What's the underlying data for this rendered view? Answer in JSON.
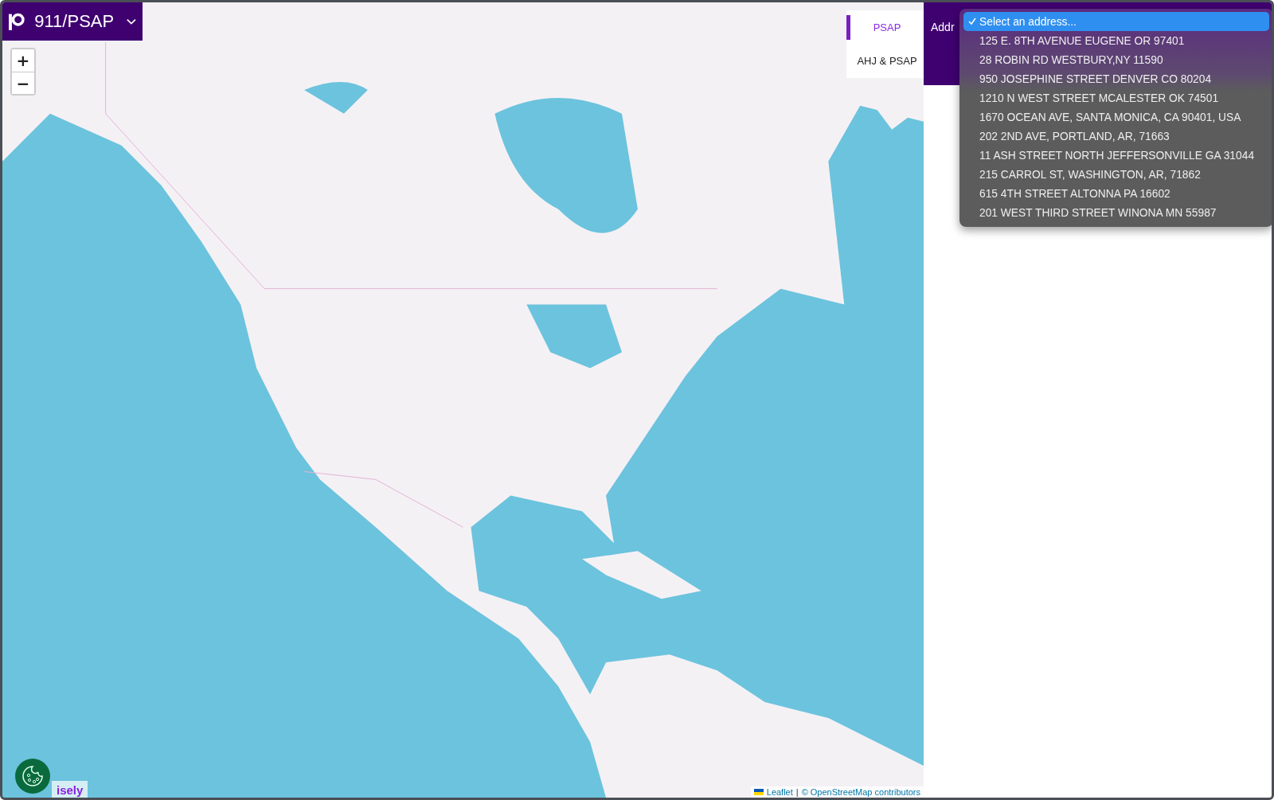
{
  "app_menu": {
    "title": "911/PSAP"
  },
  "zoom_controls": [
    "+",
    "−"
  ],
  "tabs": [
    {
      "label": "PSAP",
      "selected": true
    },
    {
      "label": "AHJ & PSAP",
      "selected": false
    }
  ],
  "address_label": "Addr",
  "address_dropdown": {
    "options": [
      {
        "label": "Select an address...",
        "selected": true
      },
      {
        "label": "125 E. 8TH AVENUE EUGENE OR 97401",
        "selected": false
      },
      {
        "label": "28 ROBIN RD WESTBURY,NY 11590",
        "selected": false
      },
      {
        "label": "950 JOSEPHINE STREET DENVER CO 80204",
        "selected": false
      },
      {
        "label": "1210 N WEST STREET MCALESTER OK 74501",
        "selected": false
      },
      {
        "label": "1670 OCEAN AVE, SANTA MONICA, CA 90401, USA",
        "selected": false
      },
      {
        "label": "202 2ND AVE, PORTLAND, AR, 71663",
        "selected": false
      },
      {
        "label": "11 ASH STREET NORTH JEFFERSONVILLE GA 31044",
        "selected": false
      },
      {
        "label": "215 CARROL ST, WASHINGTON, AR, 71862",
        "selected": false
      },
      {
        "label": "615 4TH STREET ALTONNA PA 16602",
        "selected": false
      },
      {
        "label": "201 WEST THIRD STREET WINONA MN 55987",
        "selected": false
      }
    ]
  },
  "attribution": {
    "link": "Leaflet",
    "separator": "|",
    "text": "© OpenStreetMap contributors"
  },
  "brand_logo": "isely"
}
